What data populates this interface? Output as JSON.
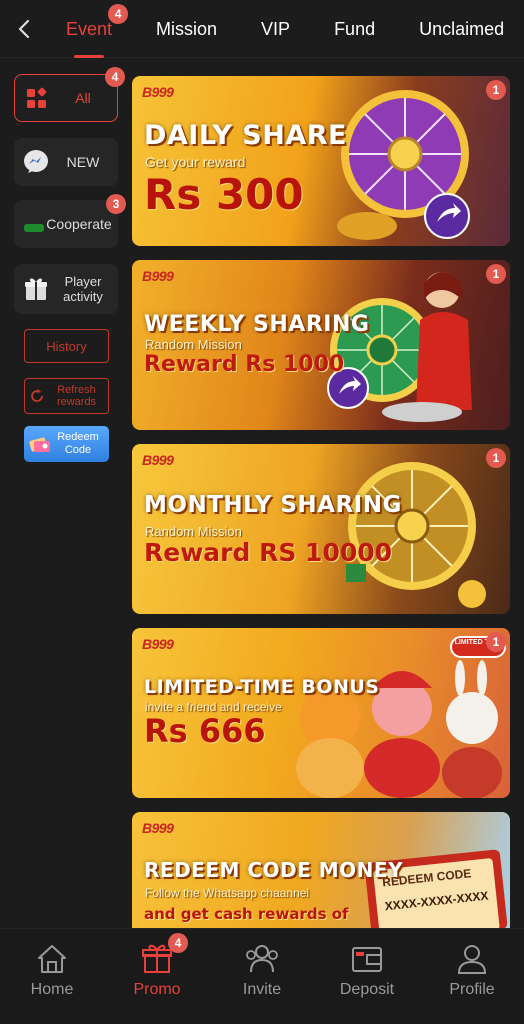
{
  "top_tabs": [
    {
      "label": "Event",
      "badge": "4",
      "active": true
    },
    {
      "label": "Mission"
    },
    {
      "label": "VIP"
    },
    {
      "label": "Fund"
    },
    {
      "label": "Unclaimed"
    }
  ],
  "sidebar": {
    "all": {
      "label": "All",
      "badge": "4"
    },
    "new": {
      "label": "NEW"
    },
    "cooperate": {
      "label": "Cooperate",
      "badge": "3"
    },
    "player_activity": {
      "label": "Player activity"
    },
    "history": {
      "label": "History"
    },
    "refresh": {
      "label": "Refresh rewards"
    },
    "redeem": {
      "label": "Redeem Code"
    }
  },
  "banners": [
    {
      "logo": "B999",
      "title": "DAILY SHARE",
      "subtitle": "Get your reward",
      "reward": "Rs 300",
      "badge": "1"
    },
    {
      "logo": "B999",
      "title": "WEEKLY SHARING",
      "subtitle": "Random Mission",
      "reward": "Reward Rs 1000",
      "badge": "1"
    },
    {
      "logo": "B999",
      "title": "MONTHLY SHARING",
      "subtitle": "Random Mission",
      "reward": "Reward RS 10000",
      "badge": "1"
    },
    {
      "logo": "B999",
      "title": "LIMITED-TIME BONUS",
      "subtitle": "invite a friend and receive",
      "reward": "Rs 666",
      "badge": "1",
      "tag": "LIMITED TIME"
    },
    {
      "logo": "B999",
      "title": "REDEEM CODE MONEY",
      "subtitle": "Follow the Whatsapp chaannel",
      "reward": "and get cash rewards of",
      "ticket_title": "REDEEM CODE",
      "ticket_code": "XXXX-XXXX-XXXX"
    }
  ],
  "bottom_nav": [
    {
      "label": "Home",
      "icon": "home-icon"
    },
    {
      "label": "Promo",
      "icon": "gift-icon",
      "badge": "4",
      "active": true
    },
    {
      "label": "Invite",
      "icon": "people-icon"
    },
    {
      "label": "Deposit",
      "icon": "wallet-icon"
    },
    {
      "label": "Profile",
      "icon": "user-icon"
    }
  ],
  "colors": {
    "accent": "#e8403a",
    "background": "#1c1c1c",
    "badge": "#e25a50",
    "banner_gold": "#f2a31a"
  }
}
